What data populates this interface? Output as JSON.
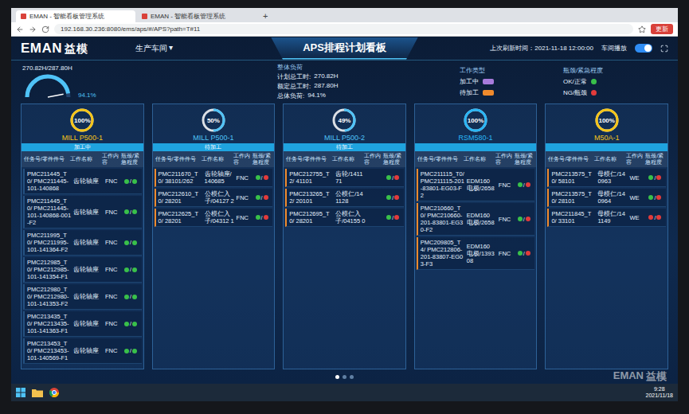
{
  "browser": {
    "tabs": [
      {
        "label": "EMAN - 智能看板管理系统",
        "selected": true
      },
      {
        "label": "EMAN - 智能看板管理系统",
        "selected": false
      }
    ],
    "new_tab": "+",
    "address": "192.168.30.236:8080/ems/aps/#/APS?path=T#11",
    "action": "更新"
  },
  "header": {
    "logo": "EMAN",
    "logo_cn": "益模",
    "workshop": "生产车间",
    "workshop_caret": "▾",
    "title": "APS排程计划看板",
    "refresh_label": "上次刷新时间：",
    "refresh_time": "2021-11-18 12:00:00",
    "autoplay_label": "车间播放",
    "autoplay_on": true
  },
  "summary": {
    "gauge_reading": "270.82H/287.80H",
    "gauge_level": 0.941,
    "gauge_percent": "94.1%",
    "load_title": "整体负荷",
    "load_items": [
      {
        "label": "计划总工时:",
        "value": "270.82H"
      },
      {
        "label": "额定总工时:",
        "value": "287.80H"
      },
      {
        "label": "总体负荷:",
        "value": "94.1%"
      }
    ],
    "type_legend": {
      "title": "工作类型",
      "items": [
        {
          "label": "加工中",
          "color": "#a77bdb"
        },
        {
          "label": "待加工",
          "color": "#f08a2c"
        }
      ]
    },
    "urgency_legend": {
      "title": "瓶颈/紧急程度",
      "items": [
        {
          "label": "OK/正常",
          "color": "#39c04a"
        },
        {
          "label": "NG/瓶颈",
          "color": "#e23b3b"
        }
      ]
    }
  },
  "columns_header": [
    "任务号/零件件号",
    "工作名称",
    "工作内容",
    "瓶颈/紧急程度"
  ],
  "separator": "/",
  "machines": [
    {
      "name": "MILL P500-1",
      "percent": "100%",
      "level": 1,
      "ring_color": "#f5c518",
      "phase": "加工中",
      "rows": [
        {
          "task": "PMC211445_T0/ PMC211445-101-140868",
          "name": "齿轮轴座",
          "content": "FNC",
          "waiting": false,
          "dots": [
            "#39c04a",
            "#39c04a"
          ]
        },
        {
          "task": "PMC211445_T0/ PMC211445-101-140868-001-F2",
          "name": "齿轮轴座",
          "content": "FNC",
          "waiting": false,
          "dots": [
            "#39c04a",
            "#39c04a"
          ]
        },
        {
          "task": "PMC211995_T0/ PMC211995-101-141364-F2",
          "name": "齿轮轴座",
          "content": "FNC",
          "waiting": false,
          "dots": [
            "#39c04a",
            "#39c04a"
          ]
        },
        {
          "task": "PMC212985_T0/ PMC212985-101-141354-F1",
          "name": "齿轮轴座",
          "content": "FNC",
          "waiting": false,
          "dots": [
            "#39c04a",
            "#39c04a"
          ]
        },
        {
          "task": "PMC212980_T0/ PMC212980-101-141353-F2",
          "name": "齿轮轴座",
          "content": "FNC",
          "waiting": false,
          "dots": [
            "#39c04a",
            "#39c04a"
          ]
        },
        {
          "task": "PMC213435_T0/ PMC213435-101-141363-F1",
          "name": "齿轮轴座",
          "content": "FNC",
          "waiting": false,
          "dots": [
            "#39c04a",
            "#39c04a"
          ]
        },
        {
          "task": "PMC213453_T0/ PMC213453-101-140569-F1",
          "name": "齿轮轴座",
          "content": "FNC",
          "waiting": false,
          "dots": [
            "#39c04a",
            "#39c04a"
          ]
        }
      ]
    },
    {
      "name": "MILL P500-1",
      "percent": "50%",
      "level": 0.5,
      "ring_color": "#4fc3f7",
      "phase": "待加工",
      "rows": [
        {
          "task": "PMC211670_T0/ 38101/262",
          "name": "齿轮轴座/ 140685",
          "content": "FNC",
          "waiting": true,
          "dots": [
            "#39c04a",
            "#e23b3b"
          ]
        },
        {
          "task": "PMC212610_T0/ 28201",
          "name": "公模仁入 子/04127 2",
          "content": "FNC",
          "waiting": true,
          "dots": [
            "#39c04a",
            "#e23b3b"
          ]
        },
        {
          "task": "PMC212625_T0/ 28201",
          "name": "公模仁入 子/04312 1",
          "content": "FNC",
          "waiting": true,
          "dots": [
            "#39c04a",
            "#e23b3b"
          ]
        }
      ]
    },
    {
      "name": "MILL P500-2",
      "percent": "49%",
      "level": 0.49,
      "ring_color": "#4fc3f7",
      "phase": "待加工",
      "rows": [
        {
          "task": "PMC212755_T2/ 41101",
          "name": "齿轮/1411 71",
          "content": "",
          "waiting": true,
          "dots": [
            "#39c04a",
            "#e23b3b"
          ]
        },
        {
          "task": "PMC213265_T2/ 20101",
          "name": "公模仁/14 1128",
          "content": "",
          "waiting": true,
          "dots": [
            "#39c04a",
            "#e23b3b"
          ]
        },
        {
          "task": "PMC212695_T0/ 28201",
          "name": "公模仁入 子/04155 0",
          "content": "",
          "waiting": true,
          "dots": [
            "#39c04a",
            "#e23b3b"
          ]
        }
      ]
    },
    {
      "name": "RSM580-1",
      "percent": "100%",
      "level": 1,
      "ring_color": "#29b6f6",
      "phase": "",
      "rows": [
        {
          "task": "PMC211115_T0/ PMC211115-201-83801-EG03-F2",
          "name": "EDM160 电极/2658",
          "content": "FNC",
          "waiting": true,
          "dots": [
            "#39c04a",
            "#e23b3b"
          ]
        },
        {
          "task": "PMC210660_T0/ PMC210660-201-83801-EG30-F2",
          "name": "EDM160 电极/2658",
          "content": "FNC",
          "waiting": true,
          "dots": [
            "#39c04a",
            "#e23b3b"
          ]
        },
        {
          "task": "PMC209805_T4/ PMC212806-201-83807-EG03-F3",
          "name": "EDM160 电极/1393 08",
          "content": "FNC",
          "waiting": true,
          "dots": [
            "#39c04a",
            "#e23b3b"
          ]
        }
      ]
    },
    {
      "name": "M50A-1",
      "percent": "100%",
      "level": 1,
      "ring_color": "#f5c518",
      "phase": "",
      "rows": [
        {
          "task": "PMC213575_T0/ 58101",
          "name": "母模仁/14 0963",
          "content": "WE",
          "waiting": true,
          "dots": [
            "#39c04a",
            "#e23b3b"
          ]
        },
        {
          "task": "PMC213575_T0/ 28101",
          "name": "母模仁/14 0964",
          "content": "WE",
          "waiting": true,
          "dots": [
            "#39c04a",
            "#e23b3b"
          ]
        },
        {
          "task": "PMC211845_T0/ 33101",
          "name": "母模仁/14 1149",
          "content": "WE",
          "waiting": true,
          "dots": [
            "#e23b3b",
            "#e23b3b"
          ]
        }
      ]
    }
  ],
  "pager": [
    {
      "selected": true
    },
    {
      "selected": false
    },
    {
      "selected": false
    }
  ],
  "watermark": {
    "text": "EMAN",
    "cn": "益模"
  },
  "taskbar": {
    "time": "9:28",
    "date": "2021/11/18"
  }
}
